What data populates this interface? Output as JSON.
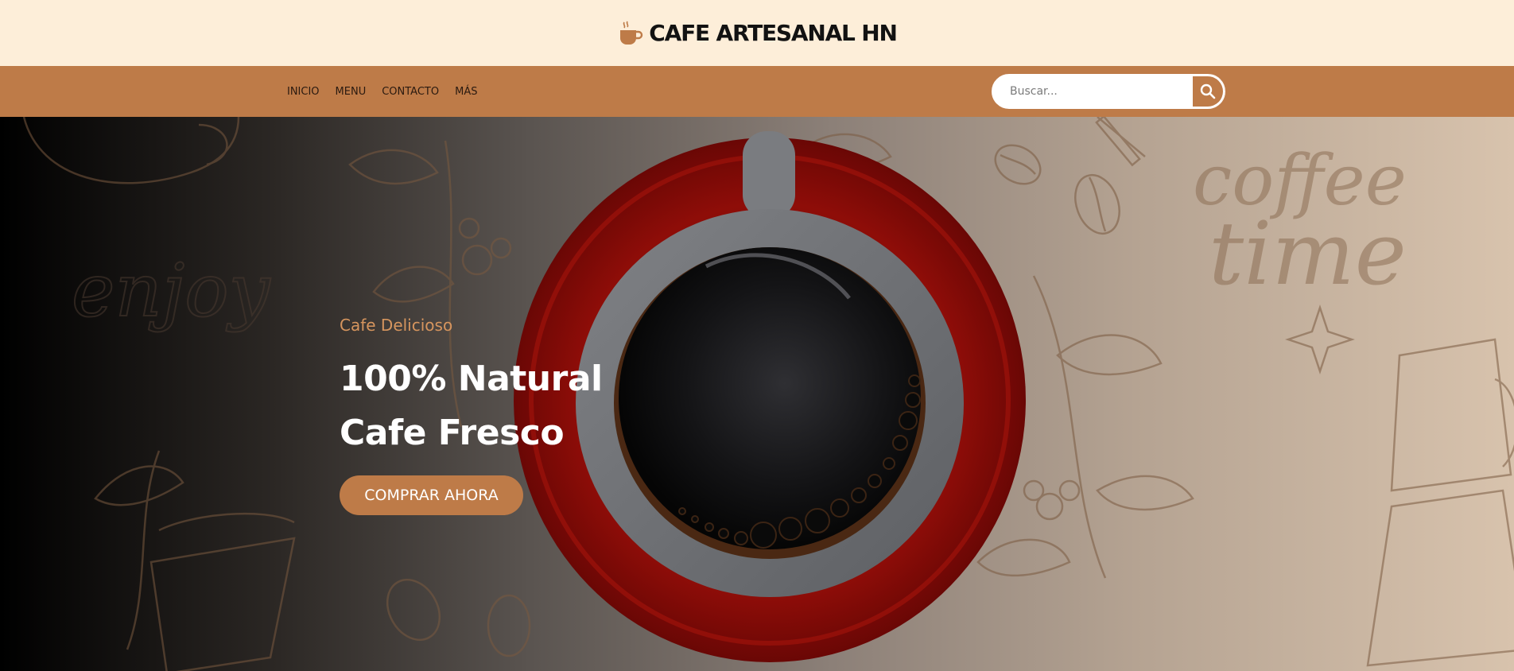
{
  "header": {
    "brand_name": "CAFE ARTESANAL HN",
    "brand_icon": "coffee-cup-icon"
  },
  "nav": {
    "items": [
      {
        "label": "INICIO"
      },
      {
        "label": "MENU"
      },
      {
        "label": "CONTACTO"
      },
      {
        "label": "MÁS"
      }
    ]
  },
  "search": {
    "placeholder": "Buscar...",
    "value": "",
    "icon": "search-icon"
  },
  "hero": {
    "kicker": "Cafe Delicioso",
    "title_line1": "100% Natural",
    "title_line2": "Cafe Fresco",
    "cta_label": "COMPRAR AHORA",
    "decor_words": [
      "enjoy",
      "coffee time"
    ]
  },
  "colors": {
    "accent": "#be7b48",
    "topbar_bg": "#fdeed9",
    "saucer": "#8b0c08",
    "cup": "#6b6d70",
    "kicker": "#d6955e"
  }
}
